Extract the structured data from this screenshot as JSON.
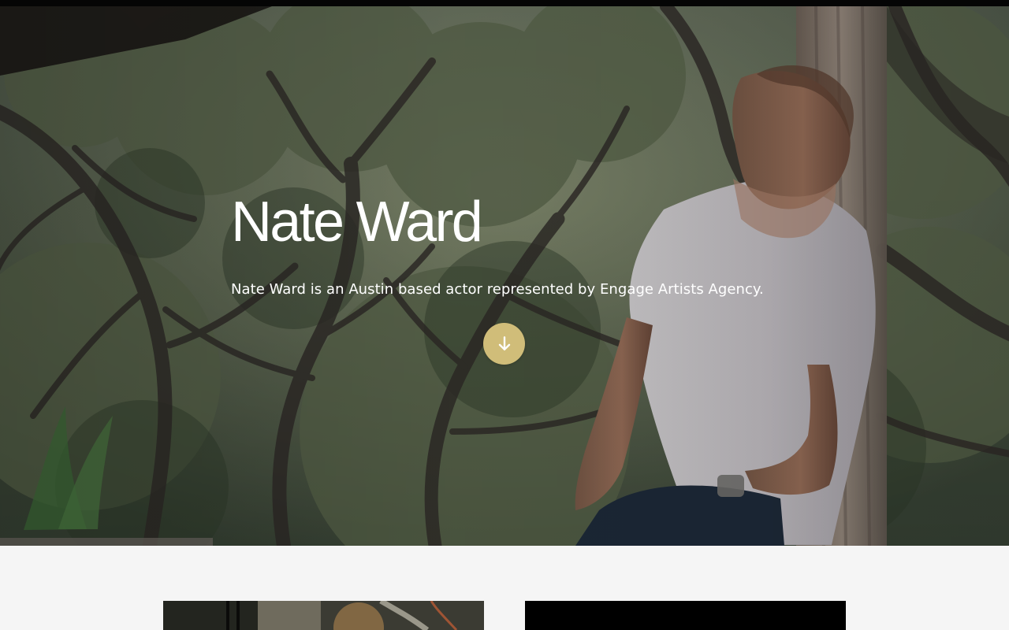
{
  "hero": {
    "title": "Nate Ward",
    "subtitle": "Nate Ward is an Austin based actor represented by Engage Artists Agency.",
    "background_icon": "portrait-photo",
    "scroll_icon": "arrow-down-icon",
    "accent_color": "#d0bd79"
  },
  "media": {
    "items": [
      {
        "icon": "photo-thumbnail"
      },
      {
        "icon": "video-thumbnail"
      }
    ]
  }
}
